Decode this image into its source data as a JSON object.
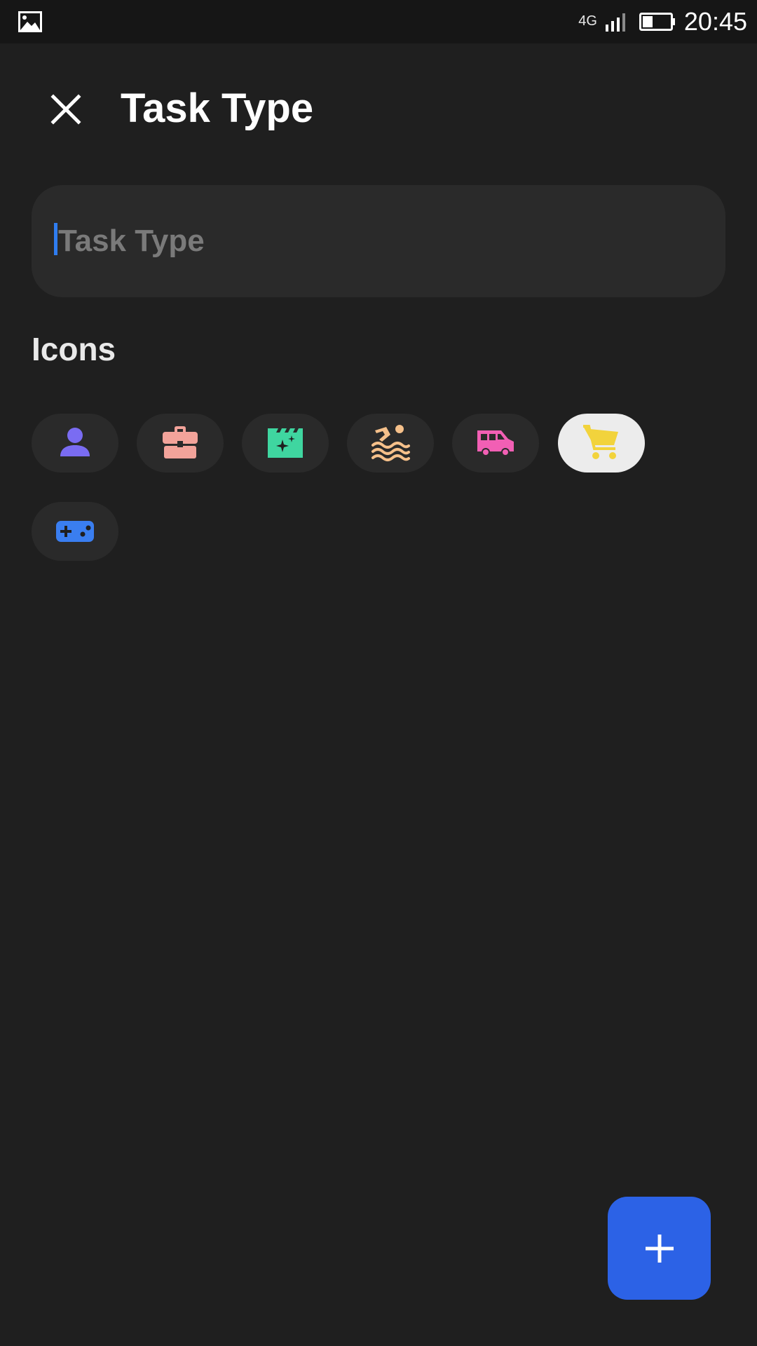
{
  "status_bar": {
    "network": "4G",
    "time": "20:45",
    "icons": [
      "gallery-icon",
      "signal-icon",
      "battery-icon"
    ]
  },
  "header": {
    "title": "Task Type",
    "close_icon": "close-icon"
  },
  "task_field": {
    "value": "",
    "placeholder": "Task Type"
  },
  "icons_section": {
    "label": "Icons",
    "items": [
      {
        "name": "person-icon",
        "color": "#7a6cf2",
        "selected": false
      },
      {
        "name": "briefcase-icon",
        "color": "#f2a39a",
        "selected": false
      },
      {
        "name": "movie-clapper-icon",
        "color": "#3fd6a0",
        "selected": false
      },
      {
        "name": "swimming-icon",
        "color": "#f5c08a",
        "selected": false
      },
      {
        "name": "van-icon",
        "color": "#f25fb4",
        "selected": false
      },
      {
        "name": "shopping-cart-icon",
        "color": "#f2d33c",
        "selected": true
      },
      {
        "name": "gamepad-icon",
        "color": "#3a7ef0",
        "selected": false
      }
    ]
  },
  "fab": {
    "icon": "plus-icon",
    "color": "#2c62e6"
  }
}
